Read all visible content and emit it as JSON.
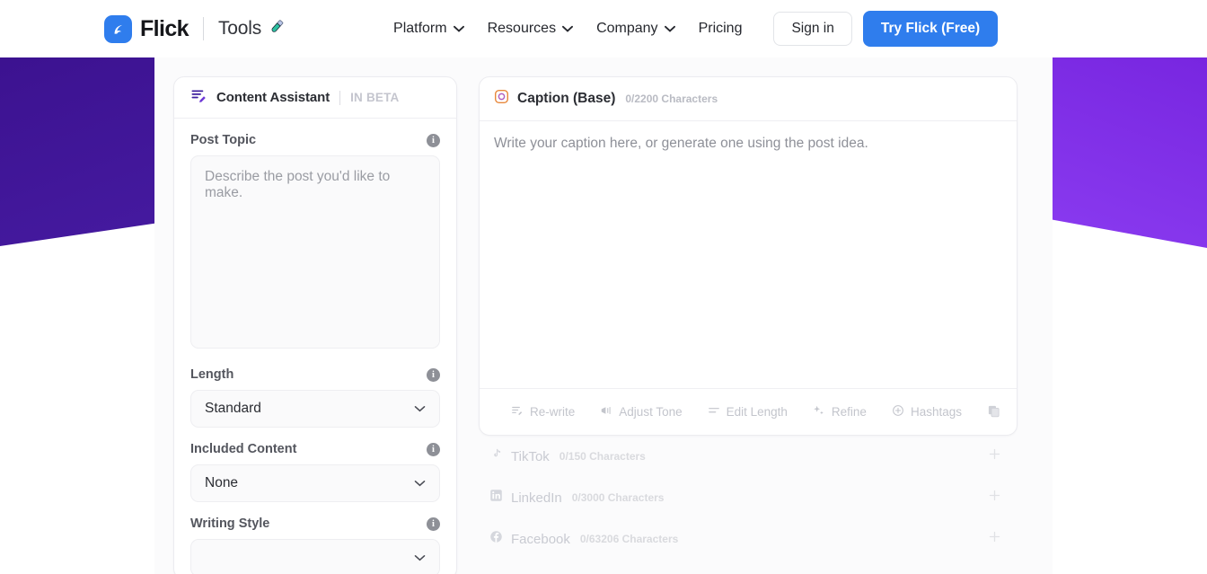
{
  "nav": {
    "brand_name": "Flick",
    "brand_section": "Tools",
    "brand_icon": "flick-logo-icon",
    "tools_icon": "test-tube-icon",
    "links": [
      {
        "label": "Platform",
        "has_chevron": true
      },
      {
        "label": "Resources",
        "has_chevron": true
      },
      {
        "label": "Company",
        "has_chevron": true
      },
      {
        "label": "Pricing",
        "has_chevron": false
      }
    ],
    "signin_label": "Sign in",
    "cta_label": "Try Flick (Free)",
    "cta_color": "#2f7ded"
  },
  "decor": {
    "left_purple": "#3c1290",
    "right_purple": "#7826e0"
  },
  "assistant": {
    "icon": "text-edit-icon",
    "title": "Content Assistant",
    "badge": "IN BETA",
    "fields": [
      {
        "label": "Post Topic",
        "type": "textarea",
        "placeholder": "Describe the post you'd like to make.",
        "value": "",
        "info_icon": "info-icon"
      },
      {
        "label": "Length",
        "type": "select",
        "value": "Standard",
        "info_icon": "info-icon"
      },
      {
        "label": "Included Content",
        "type": "select",
        "value": "None",
        "info_icon": "info-icon"
      },
      {
        "label": "Writing Style",
        "type": "select",
        "value": "",
        "info_icon": "info-icon"
      }
    ]
  },
  "caption": {
    "platform_icon": "instagram-icon",
    "title": "Caption (Base)",
    "char_count": "0/2200 Characters",
    "placeholder": "Write your caption here, or generate one using the post idea.",
    "value": "",
    "tools": [
      {
        "label": "Re-write",
        "icon": "rewrite-icon"
      },
      {
        "label": "Adjust Tone",
        "icon": "megaphone-icon"
      },
      {
        "label": "Edit Length",
        "icon": "lines-icon"
      },
      {
        "label": "Refine",
        "icon": "sparkle-icon"
      },
      {
        "label": "Hashtags",
        "icon": "plus-circle-icon"
      }
    ],
    "copy_icon": "copy-icon"
  },
  "platforms": [
    {
      "name": "TikTok",
      "icon": "tiktok-icon",
      "char_count": "0/150 Characters",
      "add_icon": "plus-icon"
    },
    {
      "name": "LinkedIn",
      "icon": "linkedin-icon",
      "char_count": "0/3000 Characters",
      "add_icon": "plus-icon"
    },
    {
      "name": "Facebook",
      "icon": "facebook-icon",
      "char_count": "0/63206 Characters",
      "add_icon": "plus-icon"
    }
  ]
}
